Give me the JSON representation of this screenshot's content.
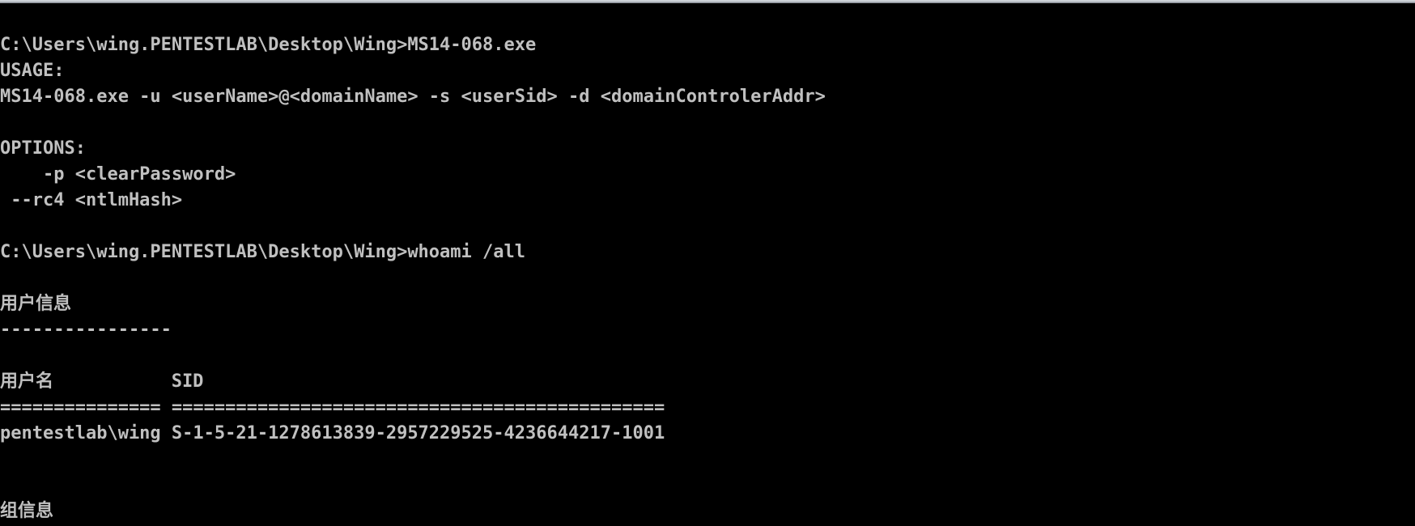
{
  "window": {
    "accent_color": "#000000",
    "text_color": "#c0c0c0"
  },
  "console": {
    "lines": [
      "C:\\Users\\wing.PENTESTLAB\\Desktop\\Wing>MS14-068.exe",
      "USAGE:",
      "MS14-068.exe -u <userName>@<domainName> -s <userSid> -d <domainControlerAddr>",
      "",
      "OPTIONS:",
      "    -p <clearPassword>",
      " --rc4 <ntlmHash>",
      "",
      "C:\\Users\\wing.PENTESTLAB\\Desktop\\Wing>whoami /all",
      "",
      "用户信息",
      "----------------",
      "",
      "用户名           SID",
      "=============== ==============================================",
      "pentestlab\\wing S-1-5-21-1278613839-2957229525-4236644217-1001",
      "",
      "",
      "组信息"
    ]
  }
}
